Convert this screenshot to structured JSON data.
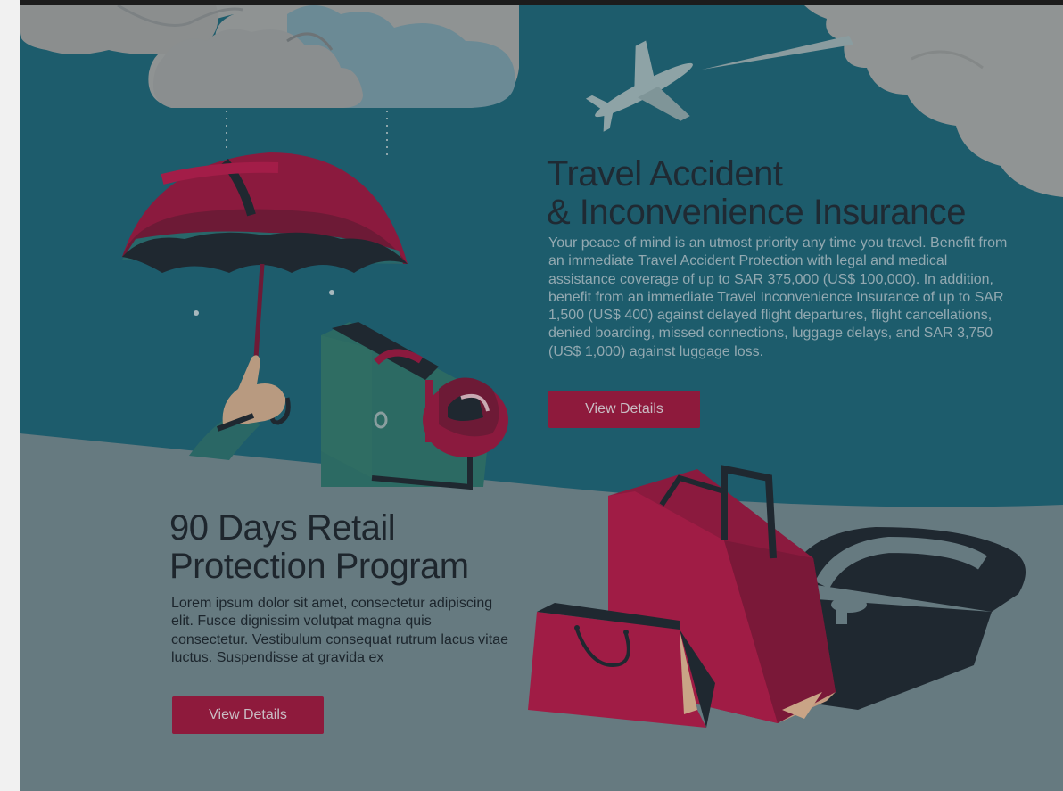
{
  "travel": {
    "title_line1": "Travel Accident",
    "title_line2": "& Inconvenience Insurance",
    "description": "Your peace of mind is an utmost priority any time you travel. Benefit from an immediate Travel Accident Protection with legal and medical assistance coverage of up to SAR 375,000 (US$ 100,000). In addition, benefit from an immediate Travel Inconvenience Insurance of up to SAR 1,500 (US$ 400) against delayed flight departures, flight cancellations, denied boarding, missed connections, luggage delays, and SAR 3,750 (US$ 1,000) against luggage loss.",
    "button_label": "View Details"
  },
  "retail": {
    "title_line1": "90 Days Retail",
    "title_line2": "Protection Program",
    "description": "Lorem ipsum dolor sit amet, consectetur adipiscing elit. Fusce dignissim volutpat magna quis consectetur. Vestibulum consequat rutrum lacus vitae luctus. Suspendisse at gravida ex",
    "button_label": "View Details"
  },
  "colors": {
    "teal_background": "#1d5c6c",
    "slate_background": "#667a80",
    "button_crimson": "#8e1a3c",
    "cloud_grey": "#8f9393"
  },
  "icons": [
    "cloud-icon",
    "airplane-icon",
    "umbrella-icon",
    "hand-icon",
    "suitcase-icon",
    "hat-icon",
    "shopping-bag-icon",
    "padlock-icon"
  ]
}
